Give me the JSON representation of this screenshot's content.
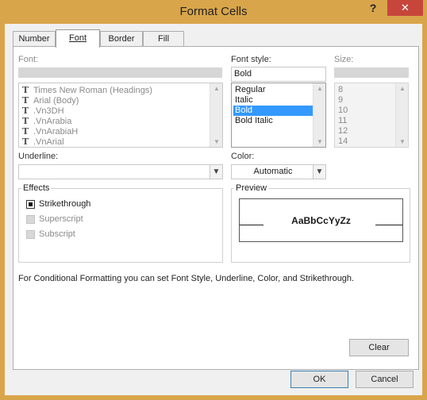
{
  "window": {
    "title": "Format Cells",
    "help": "?",
    "close": "✕"
  },
  "tabs": [
    {
      "label": "Number"
    },
    {
      "label": "Font"
    },
    {
      "label": "Border"
    },
    {
      "label": "Fill"
    }
  ],
  "font": {
    "label": "Font:",
    "value": "",
    "items": [
      "Times New Roman (Headings)",
      "Arial (Body)",
      ".Vn3DH",
      ".VnArabia",
      ".VnArabiaH",
      ".VnArial"
    ],
    "icon": "truetype-font-icon"
  },
  "font_style": {
    "label": "Font style:",
    "value": "Bold",
    "items": [
      "Regular",
      "Italic",
      "Bold",
      "Bold Italic"
    ],
    "selected": "Bold"
  },
  "size": {
    "label": "Size:",
    "value": "",
    "items": [
      "8",
      "9",
      "10",
      "11",
      "12",
      "14"
    ]
  },
  "underline": {
    "label": "Underline:",
    "value": ""
  },
  "color": {
    "label": "Color:",
    "value": "Automatic"
  },
  "effects": {
    "title": "Effects",
    "strikethrough": {
      "label": "Strikethrough",
      "checked": true
    },
    "superscript": {
      "label": "Superscript",
      "checked": false,
      "enabled": false
    },
    "subscript": {
      "label": "Subscript",
      "checked": false,
      "enabled": false
    }
  },
  "preview": {
    "title": "Preview",
    "sample": "AaBbCcYyZz"
  },
  "note": "For Conditional Formatting you can set Font Style, Underline, Color, and Strikethrough.",
  "buttons": {
    "clear": "Clear",
    "ok": "OK",
    "cancel": "Cancel"
  },
  "colors": {
    "titlebar": "#d9a54a",
    "close": "#c7463c",
    "selection": "#3399ff",
    "dialog_bg": "#f0f0f0"
  }
}
